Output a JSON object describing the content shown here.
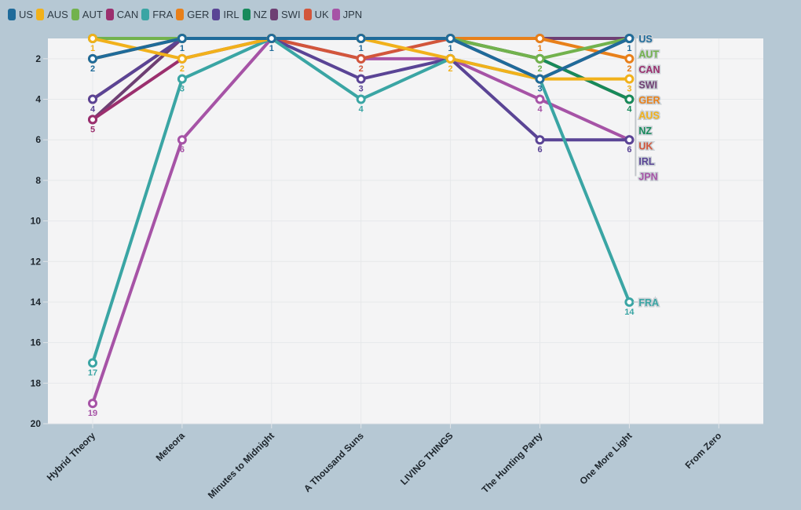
{
  "chart_data": {
    "type": "line",
    "title": "",
    "xlabel": "",
    "ylabel": "",
    "y_inverted": true,
    "ylim": [
      1,
      20
    ],
    "yticks": [
      2,
      4,
      6,
      8,
      10,
      12,
      14,
      16,
      18,
      20
    ],
    "grid": true,
    "legend_position": "top-left",
    "categories": [
      "Hybrid Theory",
      "Meteora",
      "Minutes to Midnight",
      "A Thousand Suns",
      "LIVING THINGS",
      "The Hunting Party",
      "One More Light",
      "From Zero"
    ],
    "series": [
      {
        "name": "US",
        "color": "#1f6b9a",
        "values": [
          2,
          1,
          1,
          1,
          1,
          3,
          1,
          null
        ]
      },
      {
        "name": "AUS",
        "color": "#f1b11b",
        "values": [
          1,
          2,
          1,
          1,
          2,
          3,
          3,
          null
        ]
      },
      {
        "name": "AUT",
        "color": "#72b24d",
        "values": [
          1,
          1,
          1,
          1,
          1,
          2,
          1,
          null
        ]
      },
      {
        "name": "CAN",
        "color": "#9b2f6e",
        "values": [
          5,
          2,
          1,
          1,
          1,
          3,
          1,
          null
        ]
      },
      {
        "name": "FRA",
        "color": "#3aa5a4",
        "values": [
          17,
          3,
          1,
          4,
          2,
          3,
          14,
          null
        ]
      },
      {
        "name": "GER",
        "color": "#e8801a",
        "values": [
          2,
          1,
          1,
          1,
          1,
          1,
          2,
          null
        ]
      },
      {
        "name": "IRL",
        "color": "#5a4495",
        "values": [
          4,
          1,
          1,
          3,
          2,
          6,
          6,
          null
        ]
      },
      {
        "name": "NZ",
        "color": "#178a5b",
        "values": [
          1,
          1,
          1,
          1,
          1,
          2,
          4,
          null
        ]
      },
      {
        "name": "SWI",
        "color": "#6e3f73",
        "values": [
          5,
          1,
          1,
          1,
          1,
          1,
          1,
          null
        ]
      },
      {
        "name": "UK",
        "color": "#d2563b",
        "values": [
          4,
          1,
          1,
          2,
          1,
          2,
          4,
          null
        ]
      },
      {
        "name": "JPN",
        "color": "#a653a6",
        "values": [
          19,
          6,
          1,
          2,
          2,
          4,
          6,
          null
        ]
      }
    ],
    "point_labels": [
      {
        "x": 0,
        "rank": 1,
        "color_of": "AUS"
      },
      {
        "x": 0,
        "rank": 2,
        "color_of": "US"
      },
      {
        "x": 0,
        "rank": 4,
        "color_of": "IRL"
      },
      {
        "x": 0,
        "rank": 5,
        "color_of": "CAN"
      },
      {
        "x": 0,
        "rank": 17,
        "color_of": "FRA"
      },
      {
        "x": 0,
        "rank": 19,
        "color_of": "JPN"
      },
      {
        "x": 1,
        "rank": 1,
        "color_of": "US"
      },
      {
        "x": 1,
        "rank": 2,
        "color_of": "AUS"
      },
      {
        "x": 1,
        "rank": 3,
        "color_of": "FRA"
      },
      {
        "x": 1,
        "rank": 6,
        "color_of": "JPN"
      },
      {
        "x": 2,
        "rank": 1,
        "color_of": "US"
      },
      {
        "x": 3,
        "rank": 1,
        "color_of": "US"
      },
      {
        "x": 3,
        "rank": 2,
        "color_of": "UK"
      },
      {
        "x": 3,
        "rank": 3,
        "color_of": "IRL"
      },
      {
        "x": 3,
        "rank": 4,
        "color_of": "FRA"
      },
      {
        "x": 4,
        "rank": 1,
        "color_of": "US"
      },
      {
        "x": 4,
        "rank": 2,
        "color_of": "AUS"
      },
      {
        "x": 5,
        "rank": 1,
        "color_of": "GER"
      },
      {
        "x": 5,
        "rank": 2,
        "color_of": "AUT"
      },
      {
        "x": 5,
        "rank": 3,
        "color_of": "US"
      },
      {
        "x": 5,
        "rank": 4,
        "color_of": "JPN"
      },
      {
        "x": 5,
        "rank": 6,
        "color_of": "IRL"
      },
      {
        "x": 6,
        "rank": 1,
        "color_of": "US"
      },
      {
        "x": 6,
        "rank": 2,
        "color_of": "GER"
      },
      {
        "x": 6,
        "rank": 3,
        "color_of": "AUS"
      },
      {
        "x": 6,
        "rank": 4,
        "color_of": "NZ"
      },
      {
        "x": 6,
        "rank": 6,
        "color_of": "IRL"
      },
      {
        "x": 6,
        "rank": 14,
        "color_of": "FRA"
      }
    ],
    "end_labels": [
      "US",
      "AUT",
      "CAN",
      "SWI",
      "GER",
      "AUS",
      "NZ",
      "UK",
      "IRL",
      "JPN"
    ],
    "end_label_fra": "FRA"
  }
}
